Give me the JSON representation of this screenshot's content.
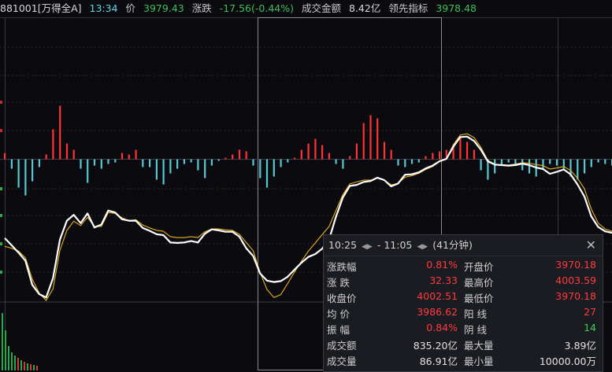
{
  "header": {
    "code": "881001[万得全A]",
    "time": "13:34",
    "price_label": "价",
    "price": "3979.43",
    "change_label": "涨跌",
    "change": "-17.56(-0.44%)",
    "turnover_label": "成交金额",
    "turnover": "8.42亿",
    "lead_label": "领先指标",
    "lead": "3978.48"
  },
  "colors": {
    "up": "#ff3333",
    "down": "#55c8d4",
    "price_line": "#ffffff",
    "lead_line": "#e8b41c",
    "grid": "#3a3a44"
  },
  "tooltip": {
    "range_start": "10:25",
    "range_end": "11:05",
    "duration": "(41分钟)",
    "close_icon": "close-icon",
    "rows": [
      {
        "l1": "涨跌幅",
        "v1": "0.81%",
        "c1": "red",
        "l2": "开盘价",
        "v2": "3970.18",
        "c2": "red"
      },
      {
        "l1": "涨  跌",
        "v1": "32.33",
        "c1": "red",
        "l2": "最高价",
        "v2": "4003.59",
        "c2": "red"
      },
      {
        "l1": "收盘价",
        "v1": "4002.51",
        "c1": "red",
        "l2": "最低价",
        "v2": "3970.18",
        "c2": "red"
      },
      {
        "l1": "均  价",
        "v1": "3986.62",
        "c1": "red",
        "l2": "阳  线",
        "v2": "27",
        "c2": "red"
      },
      {
        "l1": "振  幅",
        "v1": "0.84%",
        "c1": "red",
        "l2": "阴  线",
        "v2": "14",
        "c2": "green"
      },
      {
        "l1": "成交额",
        "v1": "835.20亿",
        "c1": "white",
        "l2": "最大量",
        "v2": "3.89亿",
        "c2": "white"
      },
      {
        "l1": "成交量",
        "v1": "86.91亿",
        "c1": "white",
        "l2": "最小量",
        "v2": "10000.00万",
        "c2": "white"
      }
    ]
  },
  "chart_data": {
    "type": "line",
    "series": [
      {
        "values": [
          3982.5,
          3981.0,
          3979.5,
          3977.8,
          3972.8,
          3970.9,
          3970.2,
          3974.2,
          3982.2,
          3986.1,
          3987.3,
          3985.6,
          3987.6,
          3984.7,
          3985.3,
          3988.2,
          3987.8,
          3986.4,
          3986.1,
          3986.1,
          3984.6,
          3984.0,
          3983.3,
          3983.1,
          3981.6,
          3981.5,
          3981.6,
          3981.9,
          3981.6,
          3983.4,
          3984.3,
          3984.1,
          3983.8,
          3983.8,
          3982.8,
          3980.4,
          3978.8,
          3975.2,
          3973.7,
          3973.4,
          3973.6,
          3974.5,
          3976.0,
          3977.4,
          3978.6,
          3979.2,
          3980.3,
          3982.2,
          3986.9,
          3990.9,
          3993.3,
          3993.5,
          3994.1,
          3994.3,
          3995.0,
          3994.5,
          3993.2,
          3993.8,
          3995.6,
          3995.7,
          3996.1,
          3996.9,
          3997.5,
          3998.4,
          3998.9,
          4001.4,
          4003.4,
          4003.5,
          4002.6,
          4000.8,
          3998.4,
          3997.7,
          3997.6,
          3997.5,
          3997.6,
          3997.9,
          3997.6,
          3997.1,
          3996.8,
          3995.8,
          3996.2,
          3996.7,
          3995.7,
          3993.6,
          3991.1,
          3987.0,
          3984.8,
          3983.9,
          3983.6
        ]
      },
      {
        "values": [
          3980.8,
          3980.4,
          3979.8,
          3978.4,
          3974.0,
          3971.1,
          3969.6,
          3972.0,
          3980.0,
          3984.1,
          3986.0,
          3985.1,
          3986.8,
          3984.9,
          3984.9,
          3987.8,
          3987.6,
          3986.7,
          3986.1,
          3986.3,
          3985.2,
          3984.6,
          3984.1,
          3983.9,
          3982.8,
          3982.6,
          3982.6,
          3982.8,
          3982.6,
          3983.8,
          3984.4,
          3984.4,
          3984.2,
          3984.1,
          3983.3,
          3981.6,
          3979.9,
          3975.4,
          3971.9,
          3970.2,
          3970.8,
          3973.1,
          3975.5,
          3977.7,
          3979.8,
          3981.5,
          3983.2,
          3984.9,
          3988.2,
          3991.5,
          3993.7,
          3994.1,
          3994.5,
          3994.5,
          3994.9,
          3994.5,
          3993.5,
          3993.8,
          3995.1,
          3995.4,
          3995.9,
          3996.7,
          3997.3,
          3998.3,
          3998.9,
          4001.8,
          4003.8,
          4004.1,
          4003.3,
          4001.3,
          3998.6,
          3997.8,
          3997.6,
          3997.6,
          3997.8,
          3998.1,
          3998.0,
          3997.7,
          3997.5,
          3996.8,
          3997.0,
          3997.3,
          3996.5,
          3994.9,
          3992.7,
          3988.5,
          3985.6,
          3984.4,
          3983.9
        ]
      }
    ],
    "bars": [
      0.4,
      -0.6,
      -1.8,
      -2.3,
      -1.4,
      -0.5,
      0.3,
      1.9,
      3.4,
      1.0,
      0.6,
      -0.6,
      -1.5,
      -0.4,
      -0.6,
      -0.3,
      -0.2,
      0.4,
      0.3,
      0.6,
      -0.5,
      -0.5,
      -1.3,
      -1.6,
      -0.9,
      -0.6,
      -0.3,
      -0.2,
      -0.7,
      -1.2,
      -0.4,
      -0.1,
      0.1,
      0.3,
      0.6,
      0.5,
      -0.4,
      -1.2,
      -1.8,
      -1.1,
      -0.5,
      -0.2,
      0.1,
      0.6,
      1.0,
      1.3,
      0.9,
      0.4,
      -0.3,
      -0.6,
      0.2,
      1.0,
      2.3,
      2.8,
      2.6,
      1.1,
      0.6,
      -0.4,
      -0.5,
      -0.3,
      -0.2,
      0.2,
      0.4,
      0.5,
      0.6,
      0.9,
      1.4,
      1.1,
      0.6,
      -0.7,
      -1.3,
      -0.9,
      -0.4,
      -0.2,
      -0.4,
      -0.7,
      -0.9,
      -1.1,
      -0.6,
      -0.3,
      -0.4,
      -0.6,
      -1.1,
      -1.3,
      -0.9,
      -0.5,
      -0.2,
      -0.3,
      -0.4
    ]
  }
}
